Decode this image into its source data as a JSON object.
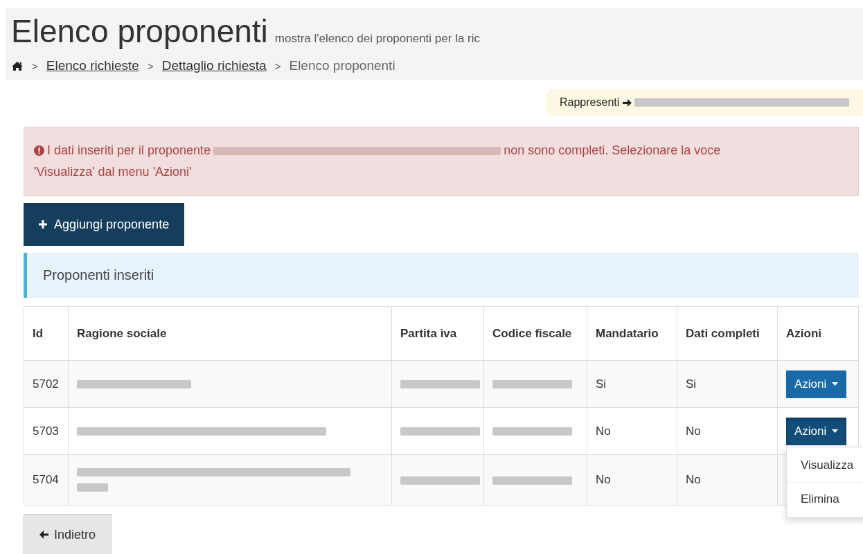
{
  "header": {
    "title": "Elenco proponenti",
    "subtitle": "mostra l'elenco dei proponenti per la ric",
    "breadcrumb": [
      {
        "label": "Elenco richieste",
        "link": true
      },
      {
        "label": "Dettaglio richiesta",
        "link": true
      },
      {
        "label": "Elenco proponenti",
        "link": false
      }
    ],
    "separator": ">"
  },
  "represent": {
    "label": "Rappresenti"
  },
  "alert": {
    "before": "I dati inseriti per il proponente",
    "after": "non sono completi. Selezionare la voce",
    "after_line2": "'Visualizza' dal menu 'Azioni'"
  },
  "add_button": {
    "label": "Aggiungi proponente"
  },
  "panel": {
    "title": "Proponenti inseriti"
  },
  "table": {
    "columns": [
      "Id",
      "Ragione sociale",
      "Partita iva",
      "Codice fiscale",
      "Mandatario",
      "Dati completi",
      "Azioni"
    ],
    "rows": [
      {
        "id": "5702",
        "mandatario": "Si",
        "dati_completi": "Si",
        "actions_label": "Azioni",
        "menu_open": false
      },
      {
        "id": "5703",
        "mandatario": "No",
        "dati_completi": "No",
        "actions_label": "Azioni",
        "menu_open": true
      },
      {
        "id": "5704",
        "mandatario": "No",
        "dati_completi": "No",
        "menu_open": false
      }
    ],
    "menu": [
      "Visualizza",
      "Elimina"
    ]
  },
  "back_button": {
    "label": "Indietro"
  }
}
